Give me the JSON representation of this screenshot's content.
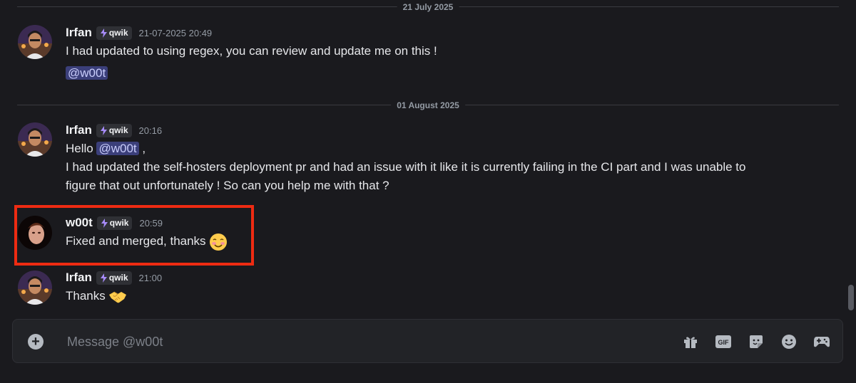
{
  "dividers": {
    "first": "21 July 2025",
    "second": "01 August 2025"
  },
  "tag_label": "qwik",
  "messages": [
    {
      "author": "Irfan",
      "timestamp": "21-07-2025 20:49",
      "line1": "I had updated to using regex, you can review and update me on this !",
      "mention": "@w00t"
    },
    {
      "author": "Irfan",
      "timestamp": "20:16",
      "hello": "Hello",
      "mention": "@w00t",
      "comma": ",",
      "line2": "I had updated the self-hosters deployment pr and had an issue with it like it is currently failing in the CI part and I was unable to",
      "line3": "figure that out unfortunately ! So can you help me with that ?"
    },
    {
      "author": "w00t",
      "timestamp": "20:59",
      "text": "Fixed and merged, thanks"
    },
    {
      "author": "Irfan",
      "timestamp": "21:00",
      "text": "Thanks"
    }
  ],
  "composer": {
    "placeholder": "Message @w00t",
    "tools": [
      "gift-icon",
      "gif-icon",
      "sticker-icon",
      "emoji-icon",
      "games-icon"
    ]
  },
  "colors": {
    "background": "#1a1a1e",
    "mention_bg": "#3b3f7a",
    "highlight_border": "#ee2b12"
  }
}
